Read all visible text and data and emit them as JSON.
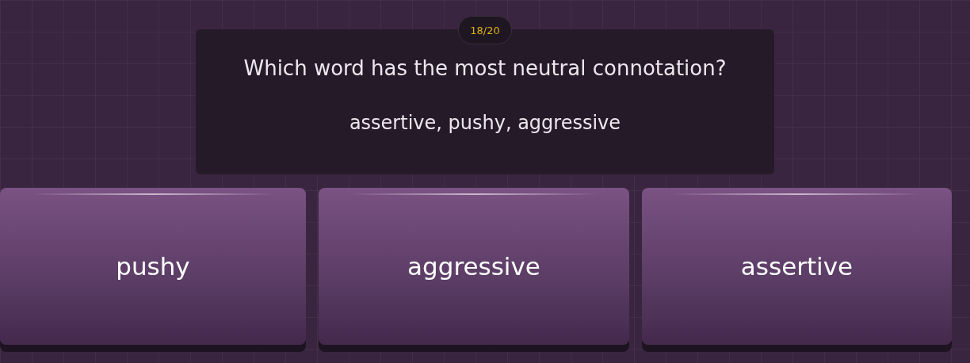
{
  "progress": "18/20",
  "question": {
    "prompt": "Which word has the most neutral connotation?",
    "words": "assertive, pushy, aggressive"
  },
  "answers": [
    {
      "label": "pushy"
    },
    {
      "label": "aggressive"
    },
    {
      "label": "assertive"
    }
  ]
}
